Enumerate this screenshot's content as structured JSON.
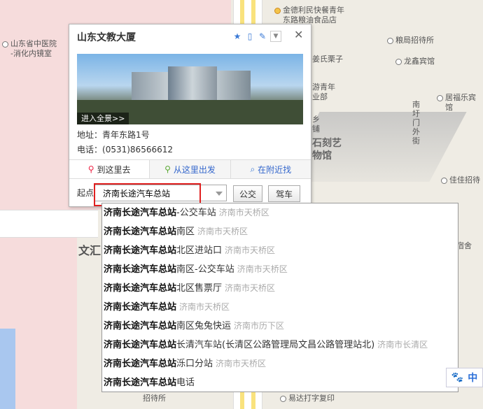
{
  "map": {
    "pois": [
      {
        "id": "hospital",
        "text": "山东省中医院\n-消化内镜室"
      },
      {
        "id": "cake",
        "text": "金德利民快餐青年\n东路粮油食品店"
      },
      {
        "id": "hotel1",
        "text": "粮局招待所"
      },
      {
        "id": "hotel2",
        "text": "龙鑫宾馆"
      },
      {
        "id": "hotel3",
        "text": "居福乐宾馆"
      },
      {
        "id": "hotel4",
        "text": "佳佳招待"
      },
      {
        "id": "chestnut",
        "text": "姜氏栗子"
      },
      {
        "id": "youth",
        "text": "游青年\n业部"
      },
      {
        "id": "art",
        "text": "石刻艺\n物馆"
      },
      {
        "id": "shop",
        "text": "乡\n铺"
      },
      {
        "id": "dorm",
        "text": "宿舍"
      },
      {
        "id": "wenhui",
        "text": "文汇"
      },
      {
        "id": "print",
        "text": "易达打字复印"
      },
      {
        "id": "guest",
        "text": "招待所"
      }
    ],
    "vertical_label": "南圩门外街"
  },
  "popup": {
    "title": "山东文教大厦",
    "enter_panorama": "进入全景>>",
    "address_label": "地址：",
    "address": "青年东路1号",
    "phone_label": "电话：",
    "phone": "(0531)86566612",
    "tabs": [
      {
        "label": "到这里去",
        "icon": "red-pin-icon"
      },
      {
        "label": "从这里出发",
        "icon": "green-pin-icon"
      },
      {
        "label": "在附近找",
        "icon": "magnifier-icon"
      }
    ],
    "start_label": "起点",
    "start_value": "济南长途汽车总站",
    "bus_button": "公交",
    "drive_button": "驾车"
  },
  "suggestions": [
    {
      "bold": "济南长途汽车总站",
      "rest": "-公交车站",
      "district": "济南市天桥区"
    },
    {
      "bold": "济南长途汽车总站",
      "rest": "南区",
      "district": "济南市天桥区"
    },
    {
      "bold": "济南长途汽车总站",
      "rest": "北区进站口",
      "district": "济南市天桥区"
    },
    {
      "bold": "济南长途汽车总站",
      "rest": "南区-公交车站",
      "district": "济南市天桥区"
    },
    {
      "bold": "济南长途汽车总站",
      "rest": "北区售票厅",
      "district": "济南市天桥区"
    },
    {
      "bold": "济南长途汽车总站",
      "rest": "",
      "district": "济南市天桥区"
    },
    {
      "bold": "济南长途汽车总站",
      "rest": "南区兔兔快运",
      "district": "济南市历下区"
    },
    {
      "bold": "济南长途汽车总站",
      "rest": "长清汽车站(长清区公路管理局文昌公路管理站北)",
      "district": "济南市长清区"
    },
    {
      "bold": "济南长途汽车总站",
      "rest": "泺口分站",
      "district": "济南市天桥区"
    },
    {
      "bold": "济南长途汽车总站",
      "rest": "电话",
      "district": ""
    }
  ],
  "lang_button": "中",
  "colors": {
    "accent": "#3366cc",
    "highlight_box": "#e02020"
  }
}
